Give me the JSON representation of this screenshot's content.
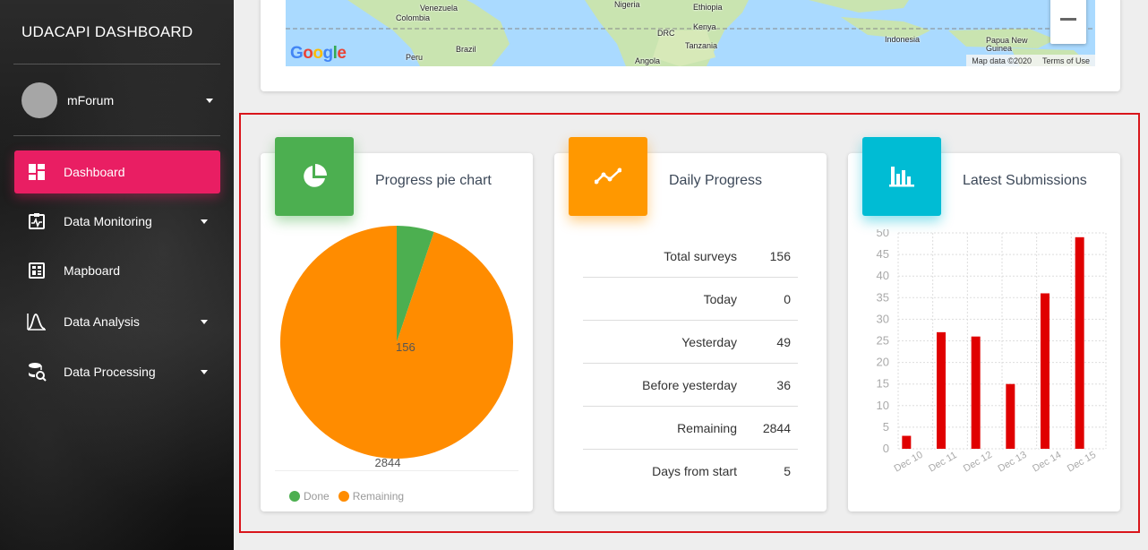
{
  "sidebar": {
    "brand": "UDACAPI DASHBOARD",
    "user": {
      "name": "mForum"
    },
    "items": [
      {
        "label": "Dashboard",
        "icon": "dashboard-icon",
        "active": true,
        "has_caret": false
      },
      {
        "label": "Data Monitoring",
        "icon": "monitor-icon",
        "active": false,
        "has_caret": true
      },
      {
        "label": "Mapboard",
        "icon": "mapboard-icon",
        "active": false,
        "has_caret": false
      },
      {
        "label": "Data Analysis",
        "icon": "analysis-icon",
        "active": false,
        "has_caret": true
      },
      {
        "label": "Data Processing",
        "icon": "database-search-icon",
        "active": false,
        "has_caret": true
      }
    ],
    "accent": "#e91e63"
  },
  "map": {
    "labels": [
      "Venezuela",
      "Colombia",
      "Peru",
      "Brazil",
      "Nigeria",
      "Ethiopia",
      "Kenya",
      "DRC",
      "Tanzania",
      "Angola",
      "Indonesia",
      "Papua New Guinea"
    ],
    "logo": "Google",
    "attribution": "Map data ©2020",
    "terms": "Terms of Use",
    "zoom_out_icon": "minus-icon"
  },
  "cards": {
    "pie": {
      "title": "Progress pie chart",
      "icon": "pie-chart-icon",
      "color": "#4caf50",
      "legend": [
        {
          "label": "Done",
          "color": "#4caf50"
        },
        {
          "label": "Remaining",
          "color": "#ff8c00"
        }
      ]
    },
    "daily": {
      "title": "Daily Progress",
      "icon": "trend-line-icon",
      "color": "#ff9800",
      "rows": [
        {
          "label": "Total surveys",
          "value": "156"
        },
        {
          "label": "Today",
          "value": "0"
        },
        {
          "label": "Yesterday",
          "value": "49"
        },
        {
          "label": "Before yesterday",
          "value": "36"
        },
        {
          "label": "Remaining",
          "value": "2844"
        },
        {
          "label": "Days from start",
          "value": "5"
        }
      ]
    },
    "latest": {
      "title": "Latest Submissions",
      "icon": "bar-chart-icon",
      "color": "#00bcd4"
    }
  },
  "chart_data": [
    {
      "type": "pie",
      "labels": [
        "Done",
        "Remaining"
      ],
      "values": [
        156,
        2844
      ],
      "colors": [
        "#4caf50",
        "#ff8c00"
      ],
      "title": "Progress pie chart",
      "legend": "bottom-left"
    },
    {
      "type": "bar",
      "title": "Latest Submissions",
      "categories": [
        "Dec 10",
        "Dec 11",
        "Dec 12",
        "Dec 13",
        "Dec 14",
        "Dec 15"
      ],
      "series": [
        {
          "values": [
            3,
            27,
            26,
            15,
            36,
            49
          ],
          "color": "#e00000"
        }
      ],
      "ylim": [
        0,
        50
      ],
      "yticks": [
        0,
        5,
        10,
        15,
        20,
        25,
        30,
        35,
        40,
        45,
        50
      ],
      "grid": true,
      "xlabel": "",
      "ylabel": ""
    }
  ]
}
